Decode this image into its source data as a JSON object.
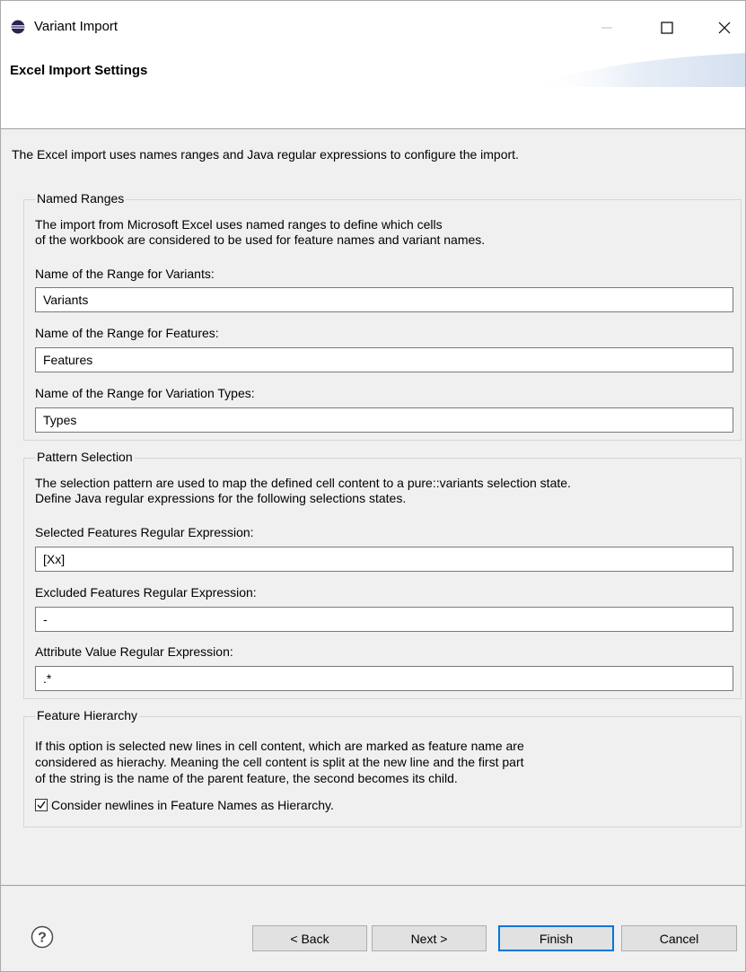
{
  "window": {
    "title": "Variant Import"
  },
  "banner": {
    "title": "Excel Import Settings"
  },
  "intro": "The Excel import uses names ranges and Java regular expressions to configure the import.",
  "named_ranges": {
    "legend": "Named Ranges",
    "description": "The import from Microsoft Excel uses named ranges to define which cells\nof the workbook are considered to be used for feature names and variant names.",
    "variants_label": "Name of the Range for Variants:",
    "variants_value": "Variants",
    "features_label": "Name of the Range for Features:",
    "features_value": "Features",
    "types_label": "Name of the Range for Variation Types:",
    "types_value": "Types"
  },
  "pattern_selection": {
    "legend": "Pattern Selection",
    "description": "The selection pattern are used to map the defined cell content to a pure::variants selection state.\nDefine Java regular expressions for the following selections states.",
    "selected_label": "Selected Features Regular Expression:",
    "selected_value": "[Xx]",
    "excluded_label": "Excluded Features Regular Expression:",
    "excluded_value": "-",
    "attribute_label": "Attribute Value Regular Expression:",
    "attribute_value": ".*"
  },
  "feature_hierarchy": {
    "legend": "Feature Hierarchy",
    "description": "If this option is selected new lines in cell content, which are marked as feature name are\nconsidered as hierachy. Meaning the cell content is split at the new line and the first part\nof the string is the name of the parent feature, the second becomes its child.",
    "checkbox_label": "Consider newlines in Feature Names as Hierarchy.",
    "checkbox_checked": true
  },
  "buttons": {
    "back": "< Back",
    "next": "Next >",
    "finish": "Finish",
    "cancel": "Cancel"
  },
  "icons": {
    "app": "eclipse-icon",
    "help": "help-icon",
    "minimize": "minimize-icon",
    "maximize": "maximize-icon",
    "close": "close-icon",
    "check": "check-icon"
  },
  "colors": {
    "dialog_bg": "#f0f0f0",
    "default_button_border": "#0078d7",
    "app_icon": "#2c2255"
  }
}
